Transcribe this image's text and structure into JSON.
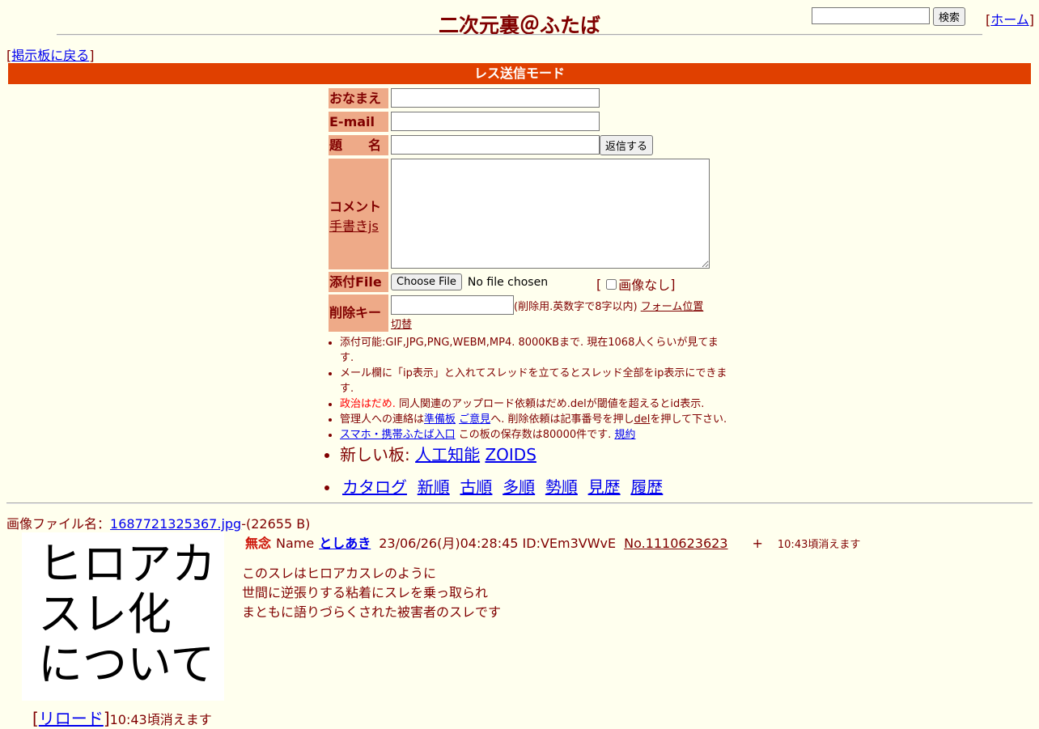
{
  "header": {
    "title": "二次元裏＠ふたば",
    "search_button": "検索",
    "home_link": "ホーム",
    "back_link": "掲示板に戻る"
  },
  "mode_bar": "レス送信モード",
  "form": {
    "name_label": "おなまえ",
    "email_label": "E-mail",
    "subject_label": "題　　名",
    "submit_button": "返信する",
    "comment_label": "コメント",
    "handwriting_link": "手書きjs",
    "file_label": "添付File",
    "choose_file_button": "Choose File",
    "no_file_text": "No file chosen",
    "no_image_label": "画像なし",
    "delete_key_label": "削除キー",
    "delete_key_note": "(削除用.英数字で8字以内)",
    "form_position_link_1": "フォーム位置",
    "form_position_link_2": "切替"
  },
  "notes": {
    "line1": "添付可能:GIF,JPG,PNG,WEBM,MP4. 8000KBまで. 現在1068人くらいが見てます.",
    "line2": "メール欄に「ip表示」と入れてスレッドを立てるとスレッド全部をip表示にできます.",
    "line3_red": "政治はだめ.",
    "line3_rest": " 同人関連のアップロード依頼はだめ.delが閾値を超えるとid表示.",
    "line4_a": "管理人への連絡は",
    "line4_link1": "準備板",
    "line4_link2": "ご意見",
    "line4_b": "へ. 削除依頼は記事番号を押し",
    "line4_link3": "del",
    "line4_c": "を押して下さい.",
    "line5_link": "スマホ・携帯ふたば入口",
    "line5_text": " この板の保存数は80000件です.",
    "line5_link2": "規約"
  },
  "new_boards": {
    "label": "新しい板: ",
    "boards": [
      "人工知能",
      "ZOIDS"
    ]
  },
  "nav_links": [
    "カタログ",
    "新順",
    "古順",
    "多順",
    "勢順",
    "見歴",
    "履歴"
  ],
  "post": {
    "file_label": "画像ファイル名：",
    "file_name": "1687721325367.jpg",
    "file_size": "-(22655 B)",
    "thumb_lines": [
      "ヒロアカ",
      "スレ化",
      "について"
    ],
    "subject": "無念",
    "name_label": "Name",
    "name": "としあき",
    "datetime": "23/06/26(月)04:28:45 ID:VEm3VWvE",
    "number": "No.1110623623",
    "plus": "+",
    "expire": "10:43頃消えます",
    "body": [
      "このスレはヒロアカスレのように",
      "世間に逆張りする粘着にスレを乗っ取られ",
      "まともに語りづらくされた被害者のスレです"
    ],
    "reload_link": "リロード",
    "expire_bottom": "10:43頃消えます"
  }
}
